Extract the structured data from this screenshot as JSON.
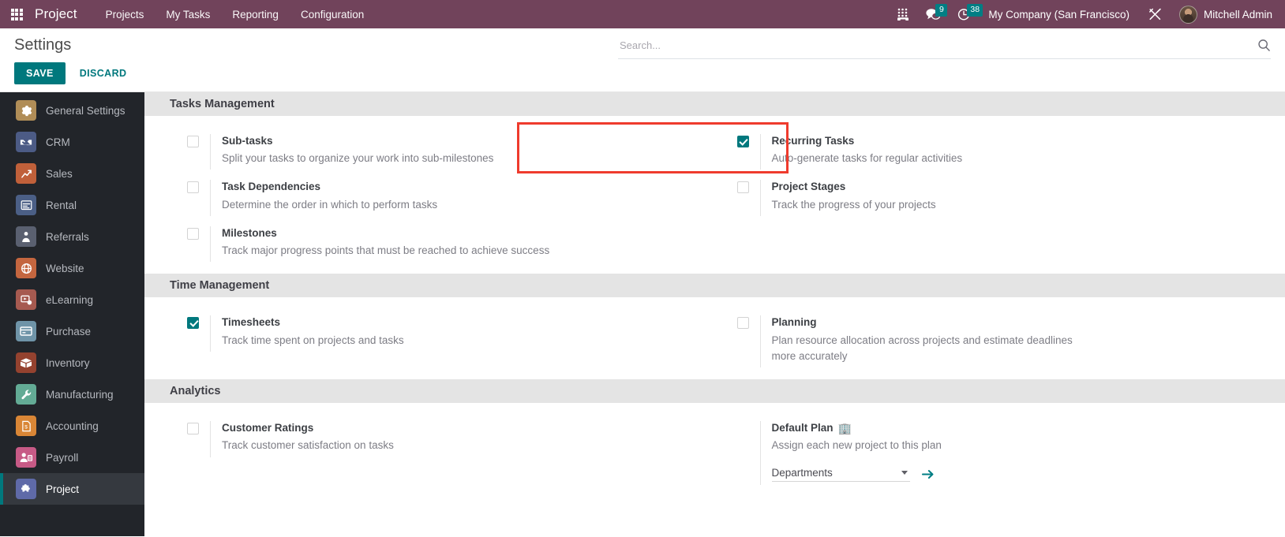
{
  "navbar": {
    "apps_icon": "apps-grid-icon",
    "brand": "Project",
    "menu": [
      {
        "label": "Projects"
      },
      {
        "label": "My Tasks"
      },
      {
        "label": "Reporting"
      },
      {
        "label": "Configuration"
      }
    ],
    "phone_icon": "dialpad-icon",
    "messages_icon": "chat-bubble-icon",
    "messages_count": "9",
    "activities_icon": "clock-icon",
    "activities_count": "38",
    "company": "My Company (San Francisco)",
    "tools_icon": "crossed-tools-icon",
    "user_name": "Mitchell Admin"
  },
  "control_panel": {
    "title": "Settings",
    "save_label": "SAVE",
    "discard_label": "DISCARD"
  },
  "search": {
    "placeholder": "Search...",
    "value": "",
    "icon": "search-icon"
  },
  "sidebar": {
    "items": [
      {
        "label": "General Settings",
        "icon": "gear-icon",
        "color": "#b08d57",
        "glyph": "⚙",
        "active": false
      },
      {
        "label": "CRM",
        "icon": "handshake-icon",
        "color": "#4c5b85",
        "glyph": "☺",
        "active": false
      },
      {
        "label": "Sales",
        "icon": "chart-up-icon",
        "color": "#c0603a",
        "glyph": "↗",
        "active": false
      },
      {
        "label": "Rental",
        "icon": "calendar-icon",
        "color": "#4b5f86",
        "glyph": "▤",
        "active": false
      },
      {
        "label": "Referrals",
        "icon": "person-gift-icon",
        "color": "#5a6070",
        "glyph": "♟",
        "active": false
      },
      {
        "label": "Website",
        "icon": "globe-icon",
        "color": "#c4663f",
        "glyph": "◔",
        "active": false
      },
      {
        "label": "eLearning",
        "icon": "screen-play-icon",
        "color": "#a65a50",
        "glyph": "▶",
        "active": false
      },
      {
        "label": "Purchase",
        "icon": "card-icon",
        "color": "#6f94a8",
        "glyph": "▭",
        "active": false
      },
      {
        "label": "Inventory",
        "icon": "box-icon",
        "color": "#94422f",
        "glyph": "⌂",
        "active": false
      },
      {
        "label": "Manufacturing",
        "icon": "wrench-icon",
        "color": "#63ab95",
        "glyph": "⚒",
        "active": false
      },
      {
        "label": "Accounting",
        "icon": "invoice-icon",
        "color": "#d98636",
        "glyph": "$",
        "active": false
      },
      {
        "label": "Payroll",
        "icon": "person-badge-icon",
        "color": "#c75a86",
        "glyph": "☻",
        "active": false
      },
      {
        "label": "Project",
        "icon": "puzzle-icon",
        "color": "#5f6aa8",
        "glyph": "▩",
        "active": true
      }
    ]
  },
  "sections": [
    {
      "title": "Tasks Management",
      "left": [
        {
          "label": "Sub-tasks",
          "desc": "Split your tasks to organize your work into sub-milestones",
          "checked": false
        },
        {
          "label": "Task Dependencies",
          "desc": "Determine the order in which to perform tasks",
          "checked": false
        },
        {
          "label": "Milestones",
          "desc": "Track major progress points that must be reached to achieve success",
          "checked": false
        }
      ],
      "right": [
        {
          "label": "Recurring Tasks",
          "desc": "Auto-generate tasks for regular activities",
          "checked": true,
          "highlighted": true
        },
        {
          "label": "Project Stages",
          "desc": "Track the progress of your projects",
          "checked": false
        }
      ]
    },
    {
      "title": "Time Management",
      "left": [
        {
          "label": "Timesheets",
          "desc": "Track time spent on projects and tasks",
          "checked": true
        }
      ],
      "right": [
        {
          "label": "Planning",
          "desc": "Plan resource allocation across projects and estimate deadlines more accurately",
          "checked": false
        }
      ]
    },
    {
      "title": "Analytics",
      "left": [
        {
          "label": "Customer Ratings",
          "desc": "Track customer satisfaction on tasks",
          "checked": false
        }
      ],
      "right": [
        {
          "label": "Default Plan",
          "label_icon": "🏢",
          "desc": "Assign each new project to this plan",
          "no_checkbox": true,
          "field": {
            "value": "Departments",
            "internal_link_icon": "arrow-right-icon"
          }
        }
      ]
    }
  ],
  "colors": {
    "navbar": "#71435b",
    "accent": "#00787d",
    "badge": "#017e84",
    "highlight": "#ef3b2d",
    "sidebar": "#22252a",
    "section_header": "#e4e4e4"
  }
}
